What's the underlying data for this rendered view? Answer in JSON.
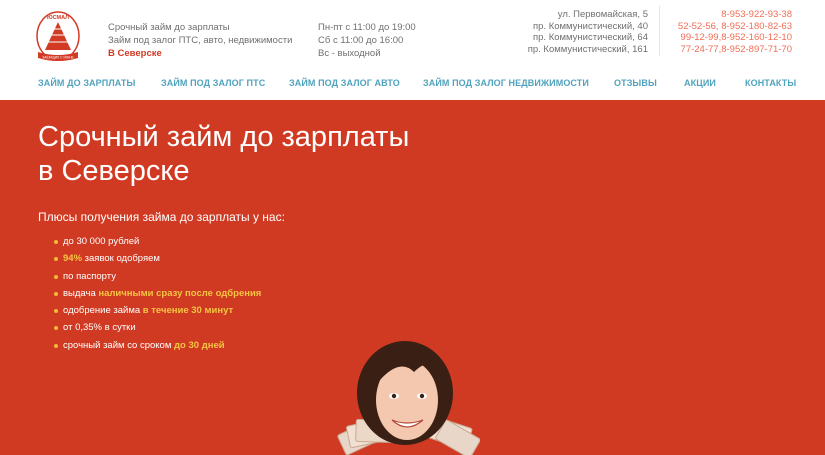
{
  "header": {
    "logo": {
      "top_text": "ЮСМАЛ",
      "ribbon_text": "ЗАЁМЩИК С ИЖНЕ"
    },
    "tagline": {
      "line1": "Срочный займ до зарплаты",
      "line2": "Займ под залог ПТС, авто, недвижимости",
      "location": "В Северске"
    },
    "hours": {
      "weekdays": "Пн-пт с 11:00 до 19:00",
      "saturday": "Сб с 11:00 до 16:00",
      "sunday": "Вс - выходной"
    },
    "addresses": [
      "ул. Первомайская, 5",
      "пр. Коммунистический, 40",
      "пр. Коммунистический, 64",
      "пр. Коммунистический, 161"
    ],
    "phones": [
      "8-953-922-93-38",
      "52-52-56, 8-952-180-82-63",
      "99-12-99,8-952-160-12-10",
      "77-24-77,8-952-897-71-70"
    ],
    "nav": [
      "ЗАЙМ ДО ЗАРПЛАТЫ",
      "ЗАЙМ ПОД ЗАЛОГ ПТС",
      "ЗАЙМ ПОД ЗАЛОГ АВТО",
      "ЗАЙМ ПОД ЗАЛОГ НЕДВИЖИМОСТИ",
      "ОТЗЫВЫ",
      "АКЦИИ",
      "КОНТАКТЫ"
    ]
  },
  "hero": {
    "title_line1": "Срочный займ до зарплаты",
    "title_line2": "в Северске",
    "benefits_heading": "Плюсы получения займа до зарплаты у нас:",
    "benefits": [
      {
        "text": "до 30 000 рублей"
      },
      {
        "highlight": "94%",
        "text": " заявок одобряем"
      },
      {
        "text": "по паспорту"
      },
      {
        "text": "выдача ",
        "highlight": "наличными сразу после одбрения"
      },
      {
        "text": "одобрение займа ",
        "highlight": "в течение 30 минут"
      },
      {
        "text": "от 0,35% в сутки"
      },
      {
        "text": "срочный займ со сроком ",
        "highlight": "до 30 дней"
      }
    ]
  },
  "colors": {
    "hero_background": "#d13a22",
    "nav_link": "#4fa3bd",
    "phone_text": "#f06e55",
    "highlight": "#f5c542",
    "brand_red": "#d23a25"
  }
}
